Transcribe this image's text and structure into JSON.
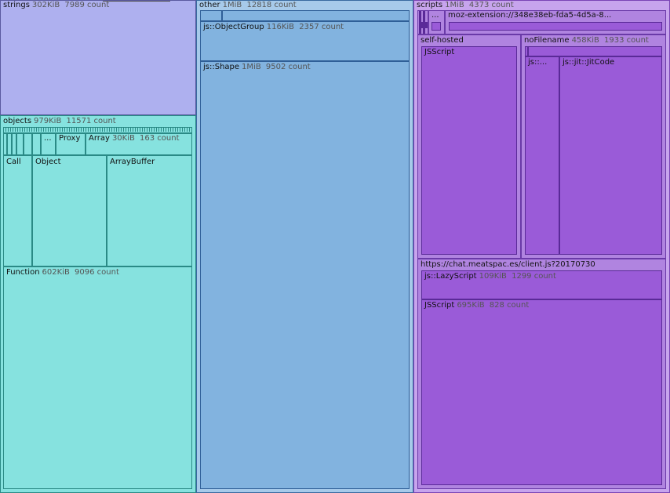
{
  "strings": {
    "name": "strings",
    "size": "302KiB",
    "count": "7989 count"
  },
  "objects": {
    "name": "objects",
    "size": "979KiB",
    "count": "11571 count",
    "ellipsis": "...",
    "proxy": {
      "name": "Proxy"
    },
    "array": {
      "name": "Array",
      "size": "30KiB",
      "count": "163 count"
    },
    "call": {
      "name": "Call"
    },
    "object": {
      "name": "Object"
    },
    "arraybuffer": {
      "name": "ArrayBuffer"
    },
    "function": {
      "name": "Function",
      "size": "602KiB",
      "count": "9096 count"
    }
  },
  "other": {
    "name": "other",
    "size": "1MiB",
    "count": "12818 count",
    "objectgroup": {
      "name": "js::ObjectGroup",
      "size": "116KiB",
      "count": "2357 count"
    },
    "shape": {
      "name": "js::Shape",
      "size": "1MiB",
      "count": "9502 count"
    }
  },
  "scripts": {
    "name": "scripts",
    "size": "1MiB",
    "count": "4373 count",
    "ellipsis": "...",
    "mozext": {
      "name": "moz-extension://348e38eb-fda5-4d5a-8..."
    },
    "selfhosted": {
      "name": "self-hosted",
      "jsscript": "JSScript"
    },
    "nofilename": {
      "name": "noFilename",
      "size": "458KiB",
      "count": "1933 count",
      "jsdots": "js::...",
      "jitcode": "js::jit::JitCode"
    },
    "meatspac": {
      "name": "https://chat.meatspac.es/client.js?20170730",
      "lazyscript": {
        "name": "js::LazyScript",
        "size": "109KiB",
        "count": "1299 count"
      },
      "jsscript": {
        "name": "JSScript",
        "size": "695KiB",
        "count": "828 count"
      }
    }
  }
}
